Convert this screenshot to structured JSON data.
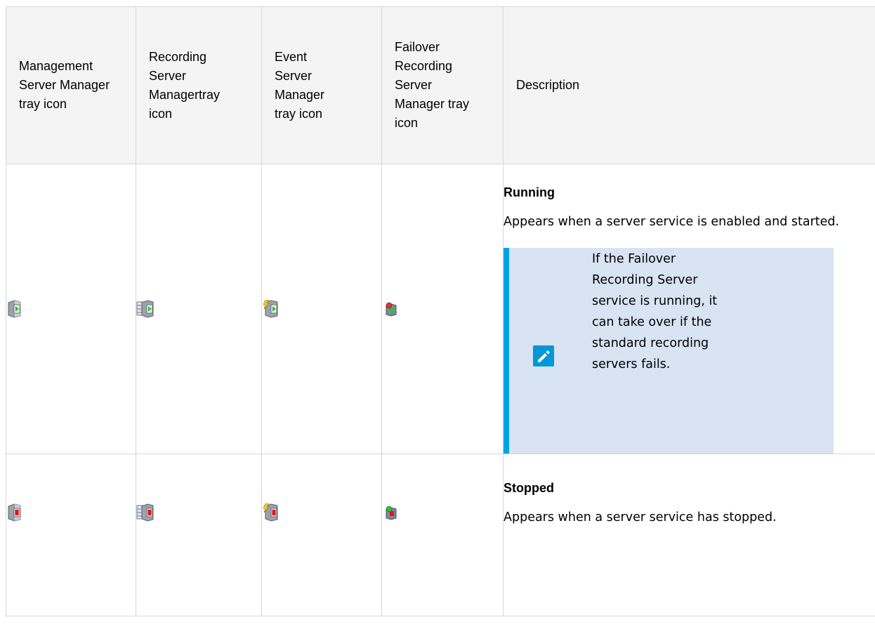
{
  "table": {
    "headers": [
      "Management\nServer Manager\ntray icon",
      "Recording\nServer\nManagertray\nicon",
      "Event\nServer\nManager\ntray icon",
      "Failover\nRecording\nServer\nManager tray\nicon",
      "Description"
    ],
    "rows": [
      {
        "status": "Running",
        "description": "Appears when a server service is enabled and started.",
        "note": "If the Failover Recording Server service is running, it can take over if the standard recording servers fails.",
        "icons": {
          "management": "management-server-running-icon",
          "recording": "recording-server-running-icon",
          "event": "event-server-running-icon",
          "failover": "failover-recording-server-running-icon"
        }
      },
      {
        "status": "Stopped",
        "description": "Appears when a server service has stopped.",
        "icons": {
          "management": "management-server-stopped-icon",
          "recording": "recording-server-stopped-icon",
          "event": "event-server-stopped-icon",
          "failover": "failover-recording-server-stopped-icon"
        }
      }
    ]
  },
  "note_icon": "pencil-note-icon",
  "colors": {
    "note_background": "#d8e3f3",
    "note_accent": "#00a3e6",
    "running_indicator": "#2fbf3a",
    "stopped_indicator": "#e0161b",
    "grid_line": "#d3d6d9",
    "header_background": "#f4f4f4"
  }
}
